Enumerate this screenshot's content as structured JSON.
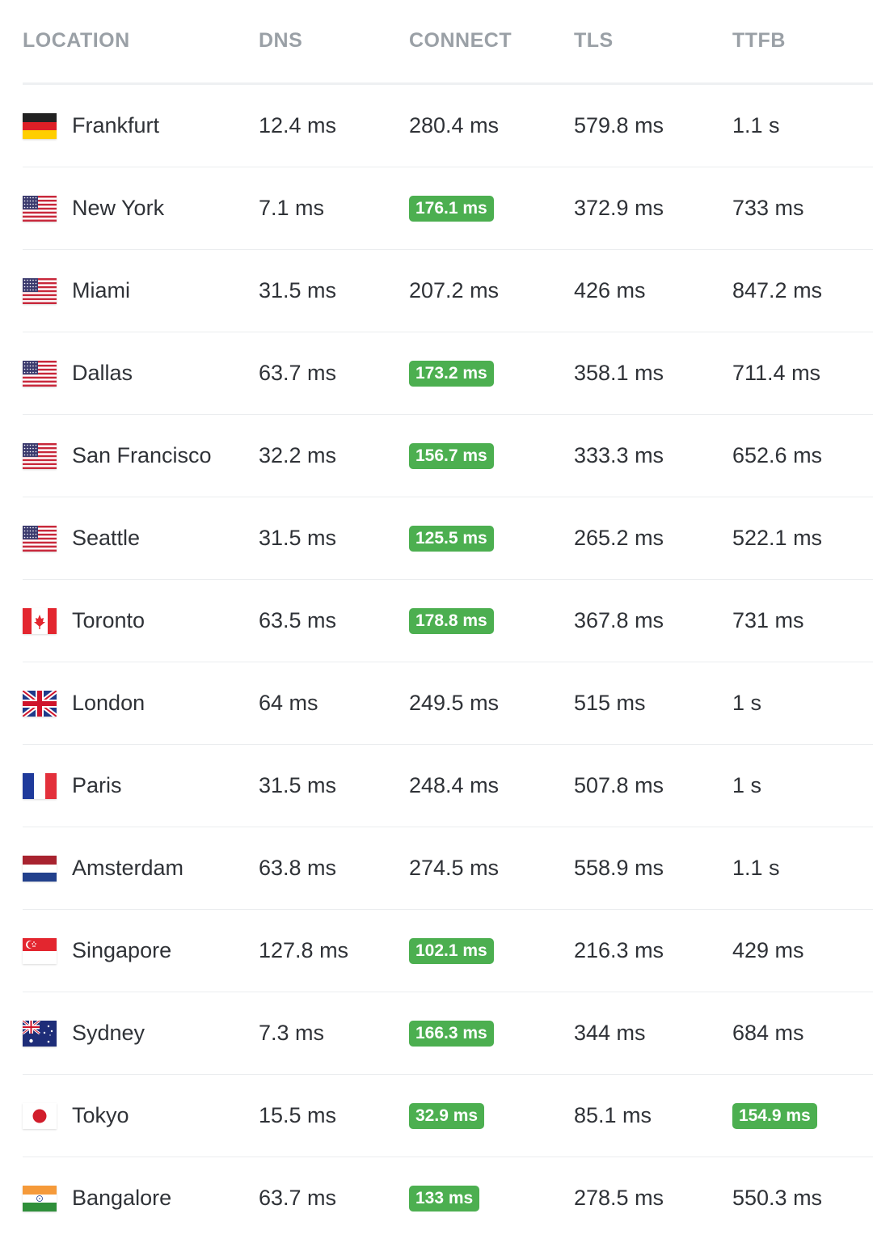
{
  "columns": {
    "location": "LOCATION",
    "dns": "DNS",
    "connect": "CONNECT",
    "tls": "TLS",
    "ttfb": "TTFB"
  },
  "colors": {
    "highlight": "#4caf50",
    "header_text": "#9aa0a6"
  },
  "rows": [
    {
      "flag": "germany-flag-icon",
      "location": "Frankfurt",
      "dns": "12.4 ms",
      "connect": "280.4 ms",
      "connect_highlight": false,
      "tls": "579.8 ms",
      "ttfb": "1.1 s",
      "ttfb_highlight": false
    },
    {
      "flag": "usa-flag-icon",
      "location": "New York",
      "dns": "7.1 ms",
      "connect": "176.1 ms",
      "connect_highlight": true,
      "tls": "372.9 ms",
      "ttfb": "733 ms",
      "ttfb_highlight": false
    },
    {
      "flag": "usa-flag-icon",
      "location": "Miami",
      "dns": "31.5 ms",
      "connect": "207.2 ms",
      "connect_highlight": false,
      "tls": "426 ms",
      "ttfb": "847.2 ms",
      "ttfb_highlight": false
    },
    {
      "flag": "usa-flag-icon",
      "location": "Dallas",
      "dns": "63.7 ms",
      "connect": "173.2 ms",
      "connect_highlight": true,
      "tls": "358.1 ms",
      "ttfb": "711.4 ms",
      "ttfb_highlight": false
    },
    {
      "flag": "usa-flag-icon",
      "location": "San Francisco",
      "dns": "32.2 ms",
      "connect": "156.7 ms",
      "connect_highlight": true,
      "tls": "333.3 ms",
      "ttfb": "652.6 ms",
      "ttfb_highlight": false
    },
    {
      "flag": "usa-flag-icon",
      "location": "Seattle",
      "dns": "31.5 ms",
      "connect": "125.5 ms",
      "connect_highlight": true,
      "tls": "265.2 ms",
      "ttfb": "522.1 ms",
      "ttfb_highlight": false
    },
    {
      "flag": "canada-flag-icon",
      "location": "Toronto",
      "dns": "63.5 ms",
      "connect": "178.8 ms",
      "connect_highlight": true,
      "tls": "367.8 ms",
      "ttfb": "731 ms",
      "ttfb_highlight": false
    },
    {
      "flag": "uk-flag-icon",
      "location": "London",
      "dns": "64 ms",
      "connect": "249.5 ms",
      "connect_highlight": false,
      "tls": "515 ms",
      "ttfb": "1 s",
      "ttfb_highlight": false
    },
    {
      "flag": "france-flag-icon",
      "location": "Paris",
      "dns": "31.5 ms",
      "connect": "248.4 ms",
      "connect_highlight": false,
      "tls": "507.8 ms",
      "ttfb": "1 s",
      "ttfb_highlight": false
    },
    {
      "flag": "netherlands-flag-icon",
      "location": "Amsterdam",
      "dns": "63.8 ms",
      "connect": "274.5 ms",
      "connect_highlight": false,
      "tls": "558.9 ms",
      "ttfb": "1.1 s",
      "ttfb_highlight": false
    },
    {
      "flag": "singapore-flag-icon",
      "location": "Singapore",
      "dns": "127.8 ms",
      "connect": "102.1 ms",
      "connect_highlight": true,
      "tls": "216.3 ms",
      "ttfb": "429 ms",
      "ttfb_highlight": false
    },
    {
      "flag": "australia-flag-icon",
      "location": "Sydney",
      "dns": "7.3 ms",
      "connect": "166.3 ms",
      "connect_highlight": true,
      "tls": "344 ms",
      "ttfb": "684 ms",
      "ttfb_highlight": false
    },
    {
      "flag": "japan-flag-icon",
      "location": "Tokyo",
      "dns": "15.5 ms",
      "connect": "32.9 ms",
      "connect_highlight": true,
      "tls": "85.1 ms",
      "ttfb": "154.9 ms",
      "ttfb_highlight": true
    },
    {
      "flag": "india-flag-icon",
      "location": "Bangalore",
      "dns": "63.7 ms",
      "connect": "133 ms",
      "connect_highlight": true,
      "tls": "278.5 ms",
      "ttfb": "550.3 ms",
      "ttfb_highlight": false
    }
  ]
}
